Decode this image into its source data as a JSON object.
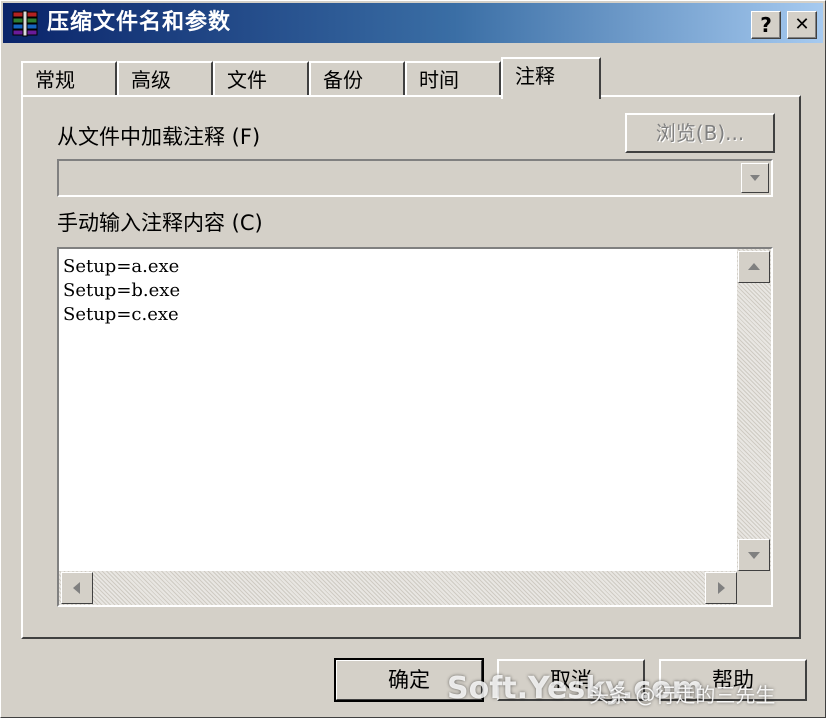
{
  "window": {
    "title": "压缩文件名和参数",
    "help_glyph": "?",
    "close_glyph": "✕"
  },
  "tabs": [
    {
      "label": "常规"
    },
    {
      "label": "高级"
    },
    {
      "label": "文件"
    },
    {
      "label": "备份"
    },
    {
      "label": "时间"
    },
    {
      "label": "注释",
      "active": true
    }
  ],
  "comment_panel": {
    "load_label": "从文件中加载注释 (F)",
    "browse_button": "浏览(B)...",
    "file_combo_value": "",
    "manual_label": "手动输入注释内容 (C)",
    "comment_lines": [
      "Setup=a.exe",
      "Setup=b.exe",
      "Setup=c.exe"
    ]
  },
  "buttons": {
    "ok": "确定",
    "cancel": "取消",
    "help": "帮助"
  },
  "watermark": {
    "main": "Soft.Yesky.com",
    "sub": "头条 @行走的三先生"
  },
  "icons": {
    "app": "archive-books-icon",
    "scroll_up": "triangle-up-icon",
    "scroll_down": "triangle-down-icon",
    "scroll_left": "triangle-left-icon",
    "scroll_right": "triangle-right-icon",
    "combo_arrow": "triangle-down-icon"
  },
  "colors": {
    "titlebar_start": "#0a246a",
    "titlebar_end": "#a6caf0",
    "face": "#d4d0c8"
  }
}
